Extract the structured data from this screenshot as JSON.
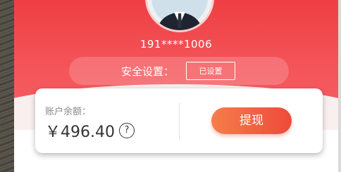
{
  "user": {
    "phone_masked": "191****1006"
  },
  "security": {
    "label": "安全设置：",
    "status_button": "已设置"
  },
  "balance": {
    "label": "账户余额：",
    "amount": "￥496.40",
    "help_icon_glyph": "?"
  },
  "actions": {
    "withdraw_label": "提现"
  },
  "colors": {
    "header_red": "#ee3f43",
    "withdraw_gradient_start": "#f57e4a",
    "withdraw_gradient_end": "#ef4a3c"
  },
  "icons": {
    "avatar": "user-avatar-icon",
    "help": "question-circle-icon"
  }
}
